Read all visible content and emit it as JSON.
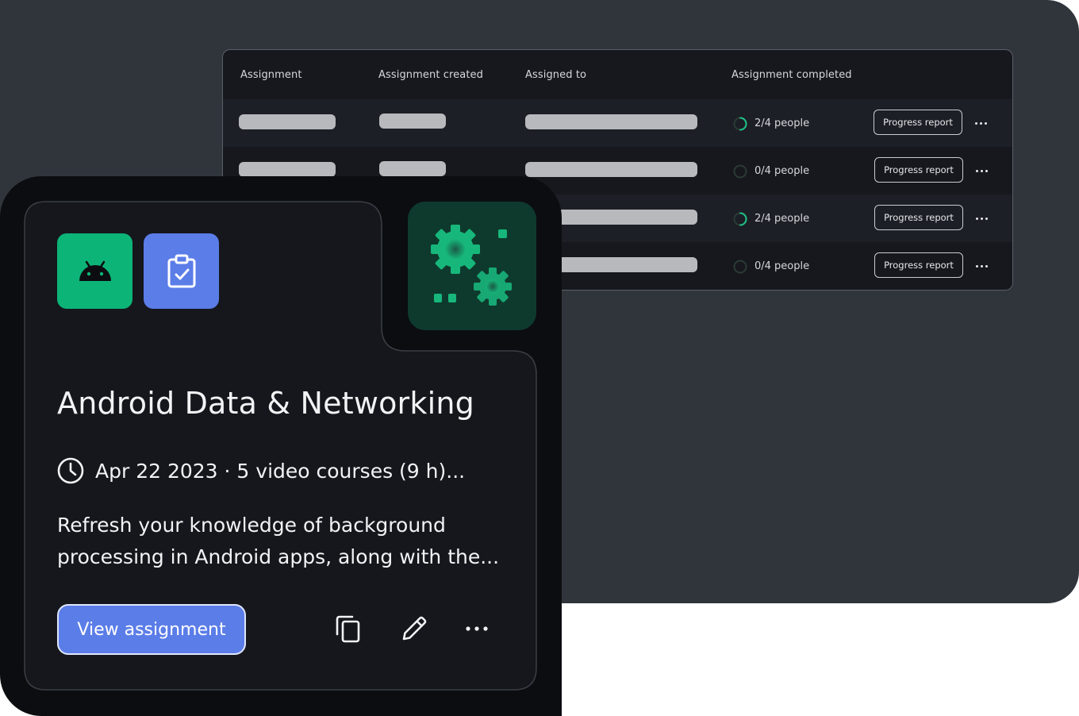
{
  "table": {
    "headers": [
      "Assignment",
      "Assignment created",
      "Assigned to",
      "Assignment completed"
    ],
    "rows": [
      {
        "completed": "2/4 people",
        "progress": 0.5,
        "action_label": "Progress report"
      },
      {
        "completed": "0/4 people",
        "progress": 0.0,
        "action_label": "Progress report"
      },
      {
        "completed": "2/4 people",
        "progress": 0.5,
        "action_label": "Progress report"
      },
      {
        "completed": "0/4 people",
        "progress": 0.0,
        "action_label": "Progress report"
      }
    ]
  },
  "card": {
    "title": "Android Data & Networking",
    "meta": "Apr 22 2023 · 5 video courses (9 h)...",
    "description": "Refresh your knowledge of background processing in Android apps, along with the...",
    "primary_button": "View assignment",
    "icons": {
      "badge_1": "android-icon",
      "badge_2": "clipboard-check-icon",
      "illustration": "gears-icon",
      "meta": "clock-icon",
      "actions": [
        "copy-icon",
        "pencil-icon",
        "more-icon"
      ]
    }
  },
  "colors": {
    "backdrop": "#30353c",
    "panel": "#16181d",
    "card": "#0c0d10",
    "android_green": "#0cb478",
    "accent_blue": "#5b7de8",
    "progress_green": "#1fc487"
  }
}
